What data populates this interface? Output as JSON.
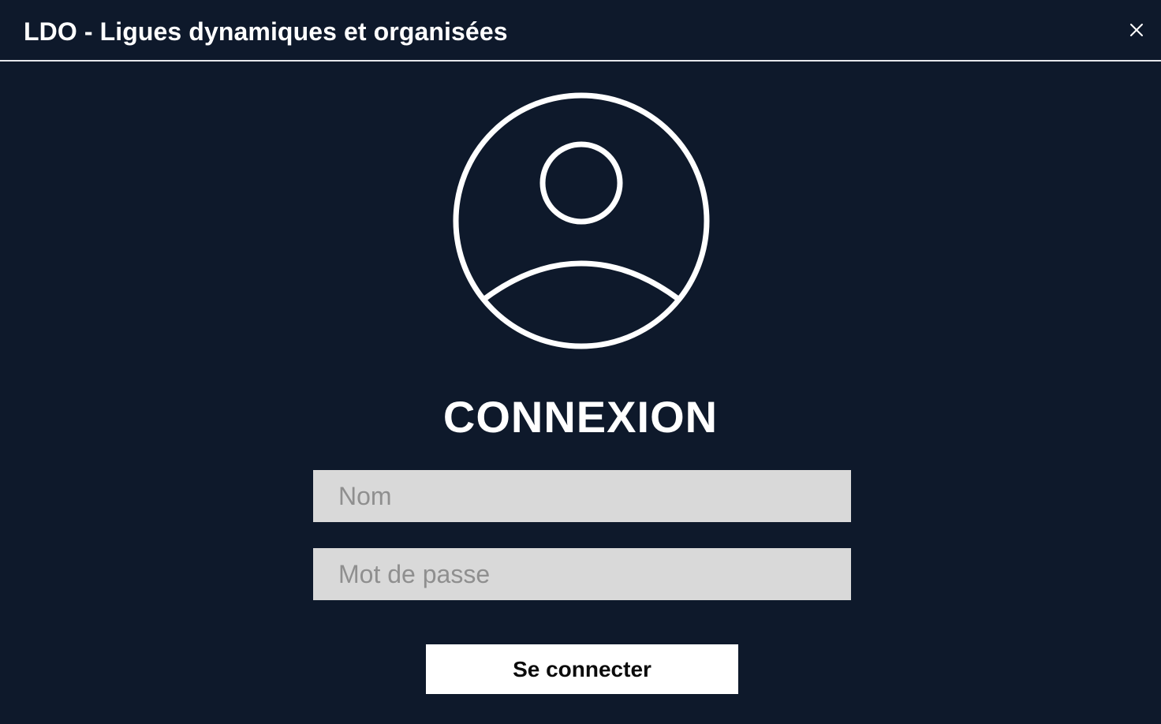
{
  "window": {
    "title": "LDO - Ligues dynamiques et organisées",
    "close_icon": "close-icon"
  },
  "login": {
    "avatar_icon": "user-avatar-icon",
    "heading": "CONNEXION",
    "username_placeholder": "Nom",
    "username_value": "",
    "password_placeholder": "Mot de passe",
    "password_value": "",
    "submit_label": "Se connecter"
  },
  "colors": {
    "background": "#0e192b",
    "field_background": "#d9d9d9",
    "placeholder": "#8f8f8f",
    "button_background": "#ffffff",
    "foreground": "#ffffff"
  }
}
